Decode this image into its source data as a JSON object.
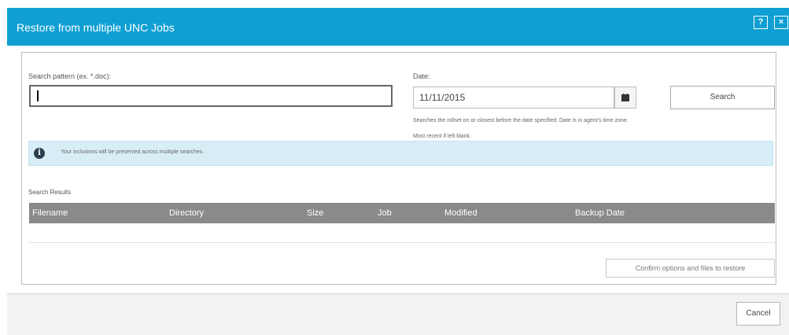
{
  "dialog": {
    "title": "Restore from multiple UNC Jobs",
    "help_label": "?",
    "close_label": "×"
  },
  "search": {
    "label": "Search pattern (ex. *.doc):",
    "value": ""
  },
  "date": {
    "label": "Date:",
    "value": "11/11/2015",
    "hint": "Searches the rollset on or closest before the date specified. Date is in agent's time zone. Most recent if left blank."
  },
  "search_button": {
    "label": "Search"
  },
  "info": {
    "icon": "info-icon",
    "text": "Your inclusions will be preserved across multiple searches."
  },
  "results": {
    "label": "Search Results",
    "columns": [
      "Filename",
      "Directory",
      "Size",
      "Job",
      "Modified",
      "Backup Date"
    ],
    "rows": []
  },
  "confirm_button": {
    "label": "Confirm options and files to restore"
  },
  "cancel_button": {
    "label": "Cancel"
  },
  "colors": {
    "title_bar": "#0f9fd3",
    "table_header": "#8a8a8a",
    "info_background": "#d8eef7"
  }
}
